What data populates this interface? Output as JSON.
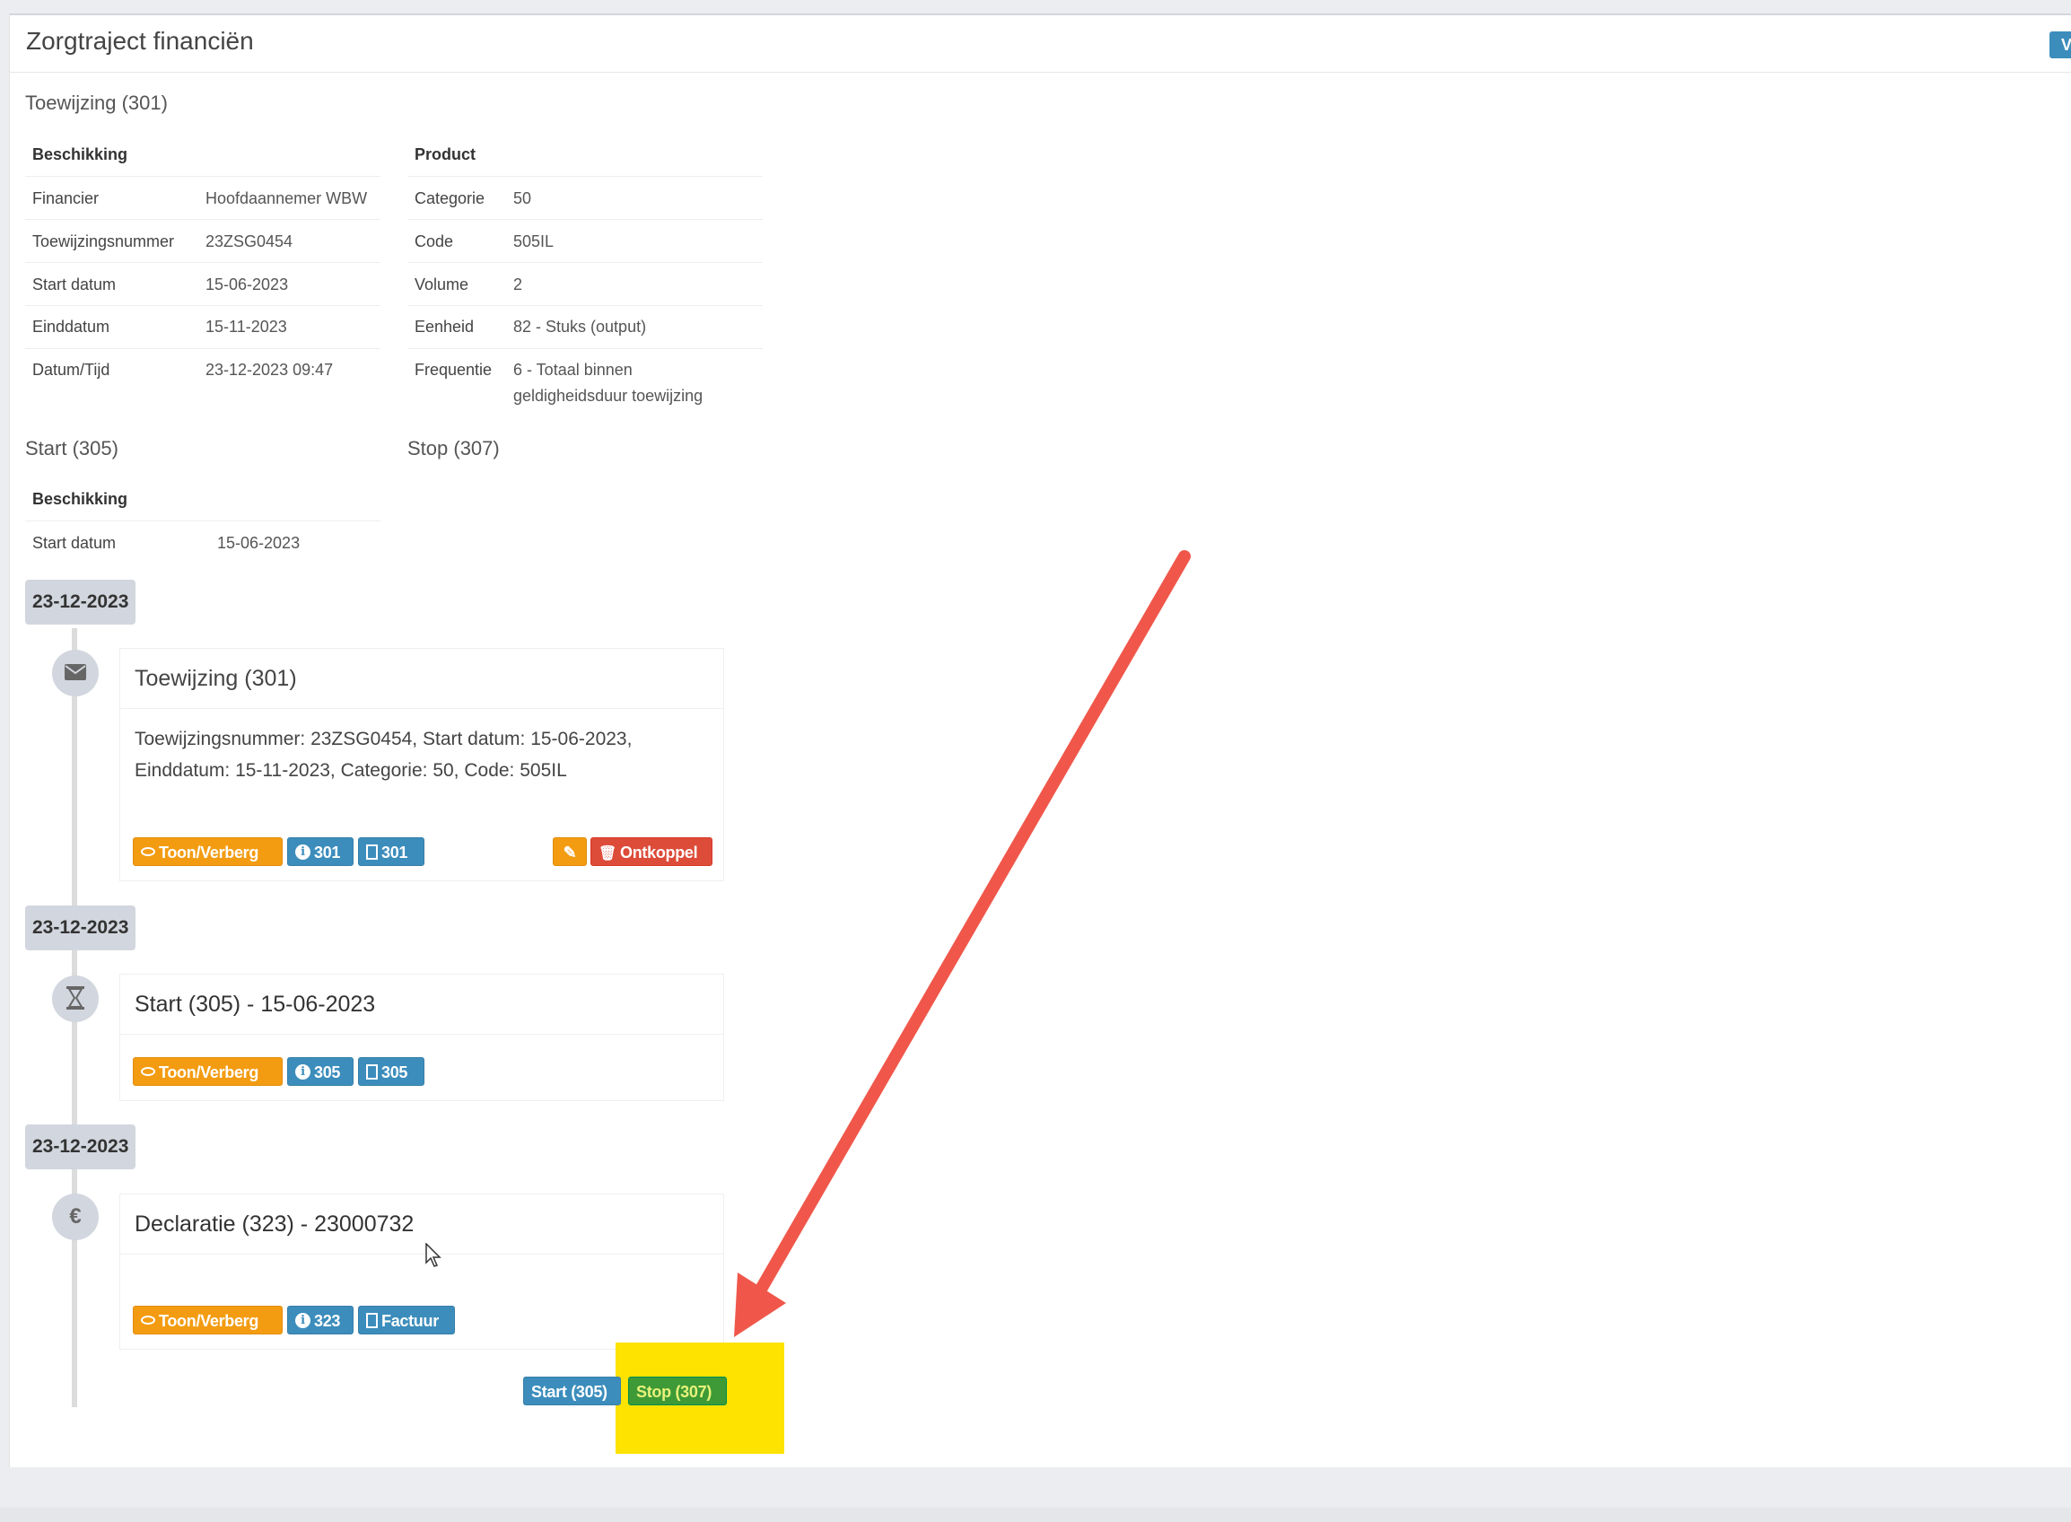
{
  "panel": {
    "title": "Zorgtraject financiën",
    "corner_button": "V"
  },
  "toewijzing": {
    "title": "Toewijzing (301)",
    "beschikking": {
      "header": "Beschikking",
      "rows": [
        {
          "label": "Financier",
          "value": "Hoofdaannemer WBW"
        },
        {
          "label": "Toewijzingsnummer",
          "value": "23ZSG0454"
        },
        {
          "label": "Start datum",
          "value": "15-06-2023"
        },
        {
          "label": "Einddatum",
          "value": "15-11-2023"
        },
        {
          "label": "Datum/Tijd",
          "value": "23-12-2023 09:47"
        }
      ]
    },
    "product": {
      "header": "Product",
      "rows": [
        {
          "label": "Categorie",
          "value": "50"
        },
        {
          "label": "Code",
          "value": "505IL"
        },
        {
          "label": "Volume",
          "value": "2"
        },
        {
          "label": "Eenheid",
          "value": "82 - Stuks (output)"
        },
        {
          "label": "Frequentie",
          "value_line1": "6 - Totaal binnen",
          "value_line2": "geldigheidsduur toewijzing"
        }
      ]
    }
  },
  "start": {
    "title": "Start (305)",
    "beschikking": {
      "header": "Beschikking",
      "rows": [
        {
          "label": "Start datum",
          "value": "15-06-2023"
        }
      ]
    }
  },
  "stop": {
    "title": "Stop (307)"
  },
  "timeline": [
    {
      "date": "23-12-2023",
      "icon": "envelope-icon",
      "title": "Toewijzing (301)",
      "body_line1": "Toewijzingsnummer: 23ZSG0454, Start datum: 15-06-2023,",
      "body_line2": "Einddatum: 15-11-2023, Categorie: 50, Code: 505IL",
      "buttons": {
        "toggle": "Toon/Verberg",
        "info": "301",
        "pdf": "301",
        "unlink": "Ontkoppel"
      }
    },
    {
      "date": "23-12-2023",
      "icon": "hourglass-icon",
      "title": "Start (305) - 15-06-2023",
      "buttons": {
        "toggle": "Toon/Verberg",
        "info": "305",
        "pdf": "305"
      }
    },
    {
      "date": "23-12-2023",
      "icon": "euro-icon",
      "title": "Declaratie (323) - 23000732",
      "buttons": {
        "toggle": "Toon/Verberg",
        "info": "323",
        "pdf": "Factuur"
      }
    }
  ],
  "footer_buttons": {
    "start": "Start (305)",
    "stop": "Stop (307)"
  },
  "colors": {
    "warning": "#f39c12",
    "info": "#3c8dbc",
    "danger": "#dd4b39",
    "success": "#00a65a",
    "highlight": "#fee200",
    "arrow": "#f0574a"
  }
}
